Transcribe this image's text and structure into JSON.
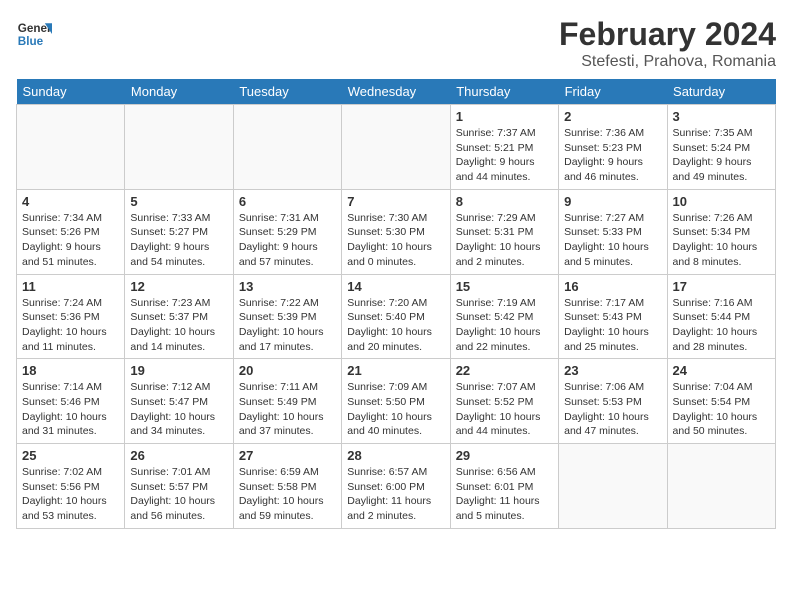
{
  "logo": {
    "line1": "General",
    "line2": "Blue"
  },
  "title": "February 2024",
  "subtitle": "Stefesti, Prahova, Romania",
  "weekdays": [
    "Sunday",
    "Monday",
    "Tuesday",
    "Wednesday",
    "Thursday",
    "Friday",
    "Saturday"
  ],
  "weeks": [
    [
      {
        "num": "",
        "info": ""
      },
      {
        "num": "",
        "info": ""
      },
      {
        "num": "",
        "info": ""
      },
      {
        "num": "",
        "info": ""
      },
      {
        "num": "1",
        "info": "Sunrise: 7:37 AM\nSunset: 5:21 PM\nDaylight: 9 hours and 44 minutes."
      },
      {
        "num": "2",
        "info": "Sunrise: 7:36 AM\nSunset: 5:23 PM\nDaylight: 9 hours and 46 minutes."
      },
      {
        "num": "3",
        "info": "Sunrise: 7:35 AM\nSunset: 5:24 PM\nDaylight: 9 hours and 49 minutes."
      }
    ],
    [
      {
        "num": "4",
        "info": "Sunrise: 7:34 AM\nSunset: 5:26 PM\nDaylight: 9 hours and 51 minutes."
      },
      {
        "num": "5",
        "info": "Sunrise: 7:33 AM\nSunset: 5:27 PM\nDaylight: 9 hours and 54 minutes."
      },
      {
        "num": "6",
        "info": "Sunrise: 7:31 AM\nSunset: 5:29 PM\nDaylight: 9 hours and 57 minutes."
      },
      {
        "num": "7",
        "info": "Sunrise: 7:30 AM\nSunset: 5:30 PM\nDaylight: 10 hours and 0 minutes."
      },
      {
        "num": "8",
        "info": "Sunrise: 7:29 AM\nSunset: 5:31 PM\nDaylight: 10 hours and 2 minutes."
      },
      {
        "num": "9",
        "info": "Sunrise: 7:27 AM\nSunset: 5:33 PM\nDaylight: 10 hours and 5 minutes."
      },
      {
        "num": "10",
        "info": "Sunrise: 7:26 AM\nSunset: 5:34 PM\nDaylight: 10 hours and 8 minutes."
      }
    ],
    [
      {
        "num": "11",
        "info": "Sunrise: 7:24 AM\nSunset: 5:36 PM\nDaylight: 10 hours and 11 minutes."
      },
      {
        "num": "12",
        "info": "Sunrise: 7:23 AM\nSunset: 5:37 PM\nDaylight: 10 hours and 14 minutes."
      },
      {
        "num": "13",
        "info": "Sunrise: 7:22 AM\nSunset: 5:39 PM\nDaylight: 10 hours and 17 minutes."
      },
      {
        "num": "14",
        "info": "Sunrise: 7:20 AM\nSunset: 5:40 PM\nDaylight: 10 hours and 20 minutes."
      },
      {
        "num": "15",
        "info": "Sunrise: 7:19 AM\nSunset: 5:42 PM\nDaylight: 10 hours and 22 minutes."
      },
      {
        "num": "16",
        "info": "Sunrise: 7:17 AM\nSunset: 5:43 PM\nDaylight: 10 hours and 25 minutes."
      },
      {
        "num": "17",
        "info": "Sunrise: 7:16 AM\nSunset: 5:44 PM\nDaylight: 10 hours and 28 minutes."
      }
    ],
    [
      {
        "num": "18",
        "info": "Sunrise: 7:14 AM\nSunset: 5:46 PM\nDaylight: 10 hours and 31 minutes."
      },
      {
        "num": "19",
        "info": "Sunrise: 7:12 AM\nSunset: 5:47 PM\nDaylight: 10 hours and 34 minutes."
      },
      {
        "num": "20",
        "info": "Sunrise: 7:11 AM\nSunset: 5:49 PM\nDaylight: 10 hours and 37 minutes."
      },
      {
        "num": "21",
        "info": "Sunrise: 7:09 AM\nSunset: 5:50 PM\nDaylight: 10 hours and 40 minutes."
      },
      {
        "num": "22",
        "info": "Sunrise: 7:07 AM\nSunset: 5:52 PM\nDaylight: 10 hours and 44 minutes."
      },
      {
        "num": "23",
        "info": "Sunrise: 7:06 AM\nSunset: 5:53 PM\nDaylight: 10 hours and 47 minutes."
      },
      {
        "num": "24",
        "info": "Sunrise: 7:04 AM\nSunset: 5:54 PM\nDaylight: 10 hours and 50 minutes."
      }
    ],
    [
      {
        "num": "25",
        "info": "Sunrise: 7:02 AM\nSunset: 5:56 PM\nDaylight: 10 hours and 53 minutes."
      },
      {
        "num": "26",
        "info": "Sunrise: 7:01 AM\nSunset: 5:57 PM\nDaylight: 10 hours and 56 minutes."
      },
      {
        "num": "27",
        "info": "Sunrise: 6:59 AM\nSunset: 5:58 PM\nDaylight: 10 hours and 59 minutes."
      },
      {
        "num": "28",
        "info": "Sunrise: 6:57 AM\nSunset: 6:00 PM\nDaylight: 11 hours and 2 minutes."
      },
      {
        "num": "29",
        "info": "Sunrise: 6:56 AM\nSunset: 6:01 PM\nDaylight: 11 hours and 5 minutes."
      },
      {
        "num": "",
        "info": ""
      },
      {
        "num": "",
        "info": ""
      }
    ]
  ]
}
